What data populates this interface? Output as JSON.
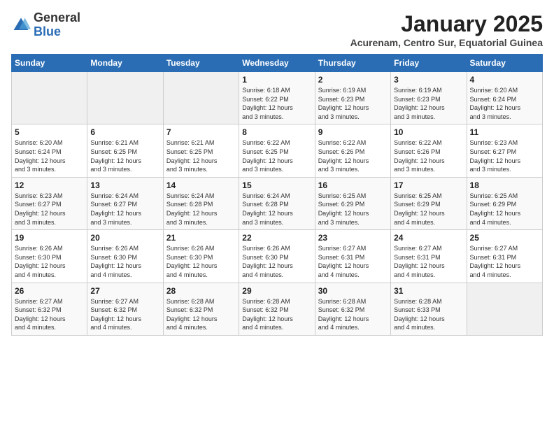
{
  "header": {
    "logo_line1": "General",
    "logo_line2": "Blue",
    "month": "January 2025",
    "location": "Acurenam, Centro Sur, Equatorial Guinea"
  },
  "weekdays": [
    "Sunday",
    "Monday",
    "Tuesday",
    "Wednesday",
    "Thursday",
    "Friday",
    "Saturday"
  ],
  "weeks": [
    [
      {
        "day": "",
        "info": ""
      },
      {
        "day": "",
        "info": ""
      },
      {
        "day": "",
        "info": ""
      },
      {
        "day": "1",
        "info": "Sunrise: 6:18 AM\nSunset: 6:22 PM\nDaylight: 12 hours\nand 3 minutes."
      },
      {
        "day": "2",
        "info": "Sunrise: 6:19 AM\nSunset: 6:23 PM\nDaylight: 12 hours\nand 3 minutes."
      },
      {
        "day": "3",
        "info": "Sunrise: 6:19 AM\nSunset: 6:23 PM\nDaylight: 12 hours\nand 3 minutes."
      },
      {
        "day": "4",
        "info": "Sunrise: 6:20 AM\nSunset: 6:24 PM\nDaylight: 12 hours\nand 3 minutes."
      }
    ],
    [
      {
        "day": "5",
        "info": "Sunrise: 6:20 AM\nSunset: 6:24 PM\nDaylight: 12 hours\nand 3 minutes."
      },
      {
        "day": "6",
        "info": "Sunrise: 6:21 AM\nSunset: 6:25 PM\nDaylight: 12 hours\nand 3 minutes."
      },
      {
        "day": "7",
        "info": "Sunrise: 6:21 AM\nSunset: 6:25 PM\nDaylight: 12 hours\nand 3 minutes."
      },
      {
        "day": "8",
        "info": "Sunrise: 6:22 AM\nSunset: 6:25 PM\nDaylight: 12 hours\nand 3 minutes."
      },
      {
        "day": "9",
        "info": "Sunrise: 6:22 AM\nSunset: 6:26 PM\nDaylight: 12 hours\nand 3 minutes."
      },
      {
        "day": "10",
        "info": "Sunrise: 6:22 AM\nSunset: 6:26 PM\nDaylight: 12 hours\nand 3 minutes."
      },
      {
        "day": "11",
        "info": "Sunrise: 6:23 AM\nSunset: 6:27 PM\nDaylight: 12 hours\nand 3 minutes."
      }
    ],
    [
      {
        "day": "12",
        "info": "Sunrise: 6:23 AM\nSunset: 6:27 PM\nDaylight: 12 hours\nand 3 minutes."
      },
      {
        "day": "13",
        "info": "Sunrise: 6:24 AM\nSunset: 6:27 PM\nDaylight: 12 hours\nand 3 minutes."
      },
      {
        "day": "14",
        "info": "Sunrise: 6:24 AM\nSunset: 6:28 PM\nDaylight: 12 hours\nand 3 minutes."
      },
      {
        "day": "15",
        "info": "Sunrise: 6:24 AM\nSunset: 6:28 PM\nDaylight: 12 hours\nand 3 minutes."
      },
      {
        "day": "16",
        "info": "Sunrise: 6:25 AM\nSunset: 6:29 PM\nDaylight: 12 hours\nand 3 minutes."
      },
      {
        "day": "17",
        "info": "Sunrise: 6:25 AM\nSunset: 6:29 PM\nDaylight: 12 hours\nand 4 minutes."
      },
      {
        "day": "18",
        "info": "Sunrise: 6:25 AM\nSunset: 6:29 PM\nDaylight: 12 hours\nand 4 minutes."
      }
    ],
    [
      {
        "day": "19",
        "info": "Sunrise: 6:26 AM\nSunset: 6:30 PM\nDaylight: 12 hours\nand 4 minutes."
      },
      {
        "day": "20",
        "info": "Sunrise: 6:26 AM\nSunset: 6:30 PM\nDaylight: 12 hours\nand 4 minutes."
      },
      {
        "day": "21",
        "info": "Sunrise: 6:26 AM\nSunset: 6:30 PM\nDaylight: 12 hours\nand 4 minutes."
      },
      {
        "day": "22",
        "info": "Sunrise: 6:26 AM\nSunset: 6:30 PM\nDaylight: 12 hours\nand 4 minutes."
      },
      {
        "day": "23",
        "info": "Sunrise: 6:27 AM\nSunset: 6:31 PM\nDaylight: 12 hours\nand 4 minutes."
      },
      {
        "day": "24",
        "info": "Sunrise: 6:27 AM\nSunset: 6:31 PM\nDaylight: 12 hours\nand 4 minutes."
      },
      {
        "day": "25",
        "info": "Sunrise: 6:27 AM\nSunset: 6:31 PM\nDaylight: 12 hours\nand 4 minutes."
      }
    ],
    [
      {
        "day": "26",
        "info": "Sunrise: 6:27 AM\nSunset: 6:32 PM\nDaylight: 12 hours\nand 4 minutes."
      },
      {
        "day": "27",
        "info": "Sunrise: 6:27 AM\nSunset: 6:32 PM\nDaylight: 12 hours\nand 4 minutes."
      },
      {
        "day": "28",
        "info": "Sunrise: 6:28 AM\nSunset: 6:32 PM\nDaylight: 12 hours\nand 4 minutes."
      },
      {
        "day": "29",
        "info": "Sunrise: 6:28 AM\nSunset: 6:32 PM\nDaylight: 12 hours\nand 4 minutes."
      },
      {
        "day": "30",
        "info": "Sunrise: 6:28 AM\nSunset: 6:32 PM\nDaylight: 12 hours\nand 4 minutes."
      },
      {
        "day": "31",
        "info": "Sunrise: 6:28 AM\nSunset: 6:33 PM\nDaylight: 12 hours\nand 4 minutes."
      },
      {
        "day": "",
        "info": ""
      }
    ]
  ]
}
